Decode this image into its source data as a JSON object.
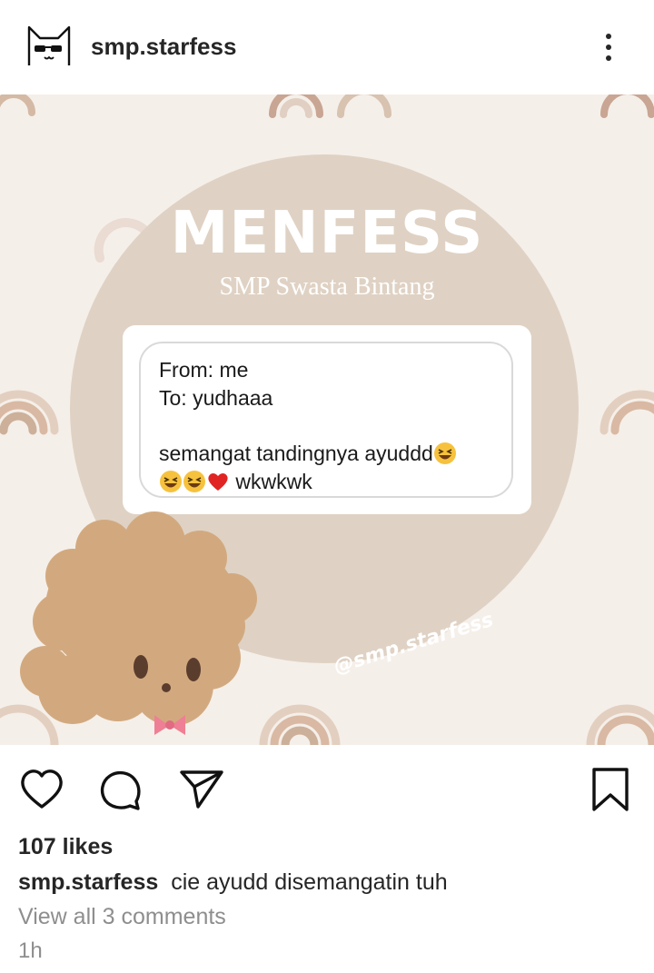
{
  "header": {
    "username": "smp.starfess",
    "avatar_icon": "cat-sunglasses-icon",
    "menu_icon": "more-vertical-icon"
  },
  "post_image": {
    "title": "MENFESS",
    "subtitle": "SMP Swasta Bintang",
    "message": {
      "from": "From: me",
      "to": "To: yudhaaa",
      "line1": "semangat tandingnya ayuddd",
      "line2": "wkwkwk"
    },
    "watermark": "@smp.starfess",
    "colors": {
      "background": "#f5efe9",
      "circle": "#dfd2c4",
      "dog": "#d2a97f"
    }
  },
  "actions": {
    "like_icon": "heart-icon",
    "comment_icon": "comment-icon",
    "share_icon": "send-icon",
    "save_icon": "bookmark-icon"
  },
  "post": {
    "likes": "107 likes",
    "caption_user": "smp.starfess",
    "caption_text": "cie ayudd disemangatin tuh",
    "view_comments": "View all 3 comments",
    "time": "1h"
  }
}
